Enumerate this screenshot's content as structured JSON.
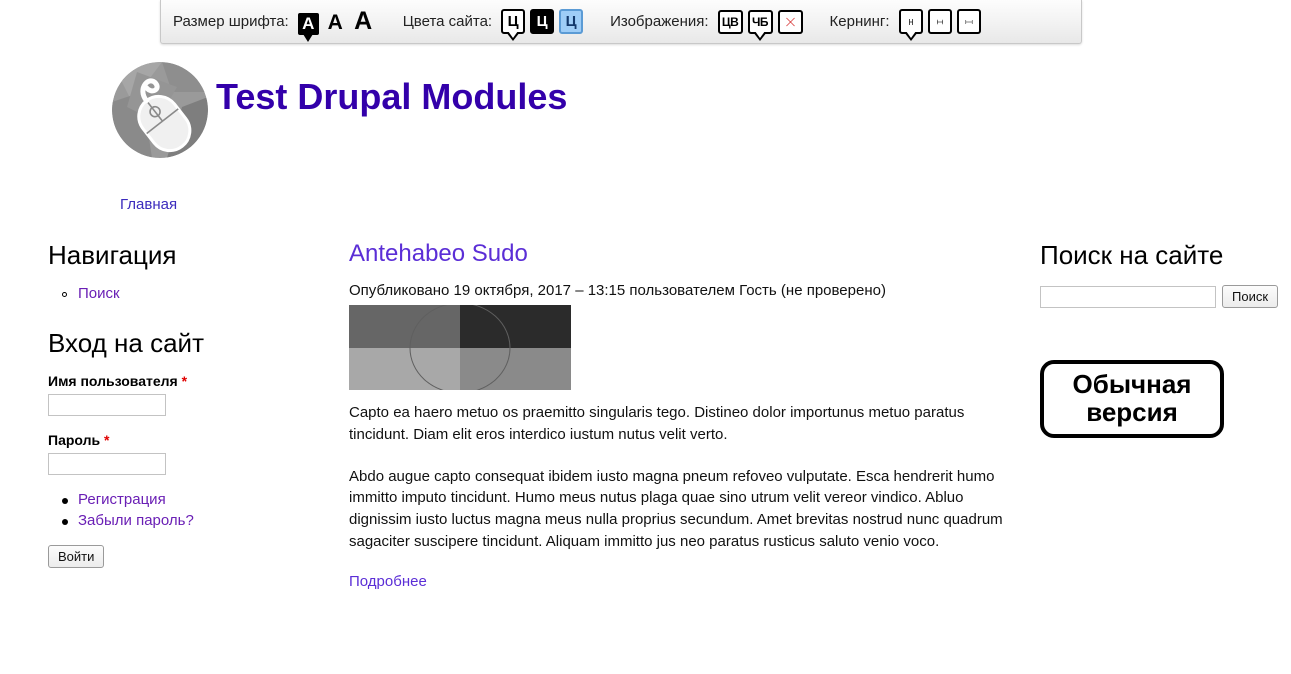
{
  "toolbar": {
    "font_size": {
      "label": "Размер шрифта:",
      "options": [
        {
          "glyph": "A",
          "name": "font-size-small",
          "active": true
        },
        {
          "glyph": "A",
          "name": "font-size-medium",
          "active": false
        },
        {
          "glyph": "A",
          "name": "font-size-large",
          "active": false
        }
      ]
    },
    "site_colors": {
      "label": "Цвета сайта:",
      "options": [
        {
          "glyph": "Ц",
          "name": "color-scheme-white",
          "active": true
        },
        {
          "glyph": "Ц",
          "name": "color-scheme-black",
          "active": false
        },
        {
          "glyph": "Ц",
          "name": "color-scheme-blue",
          "active": false
        }
      ]
    },
    "images": {
      "label": "Изображения:",
      "options": [
        {
          "glyph": "ЦВ",
          "name": "images-color",
          "active": false
        },
        {
          "glyph": "ЧБ",
          "name": "images-grayscale",
          "active": true
        },
        {
          "glyph": "",
          "name": "images-off",
          "active": false
        }
      ]
    },
    "kerning": {
      "label": "Кернинг:",
      "options": [
        {
          "name": "kerning-normal",
          "active": true
        },
        {
          "name": "kerning-medium",
          "active": false
        },
        {
          "name": "kerning-wide",
          "active": false
        }
      ]
    }
  },
  "header": {
    "site_title": "Test Drupal Modules",
    "logo_alt": "mouse-logo",
    "menu": [
      {
        "label": "Главная",
        "name": "main-menu-home"
      }
    ]
  },
  "sidebar_first": {
    "navigation": {
      "title": "Навигация",
      "items": [
        {
          "label": "Поиск",
          "name": "nav-item-search"
        }
      ]
    },
    "login": {
      "title": "Вход на сайт",
      "username_label": "Имя пользователя",
      "username_value": "",
      "password_label": "Пароль",
      "password_value": "",
      "required_mark": "*",
      "links": [
        {
          "label": "Регистрация",
          "name": "register-link"
        },
        {
          "label": "Забыли пароль?",
          "name": "forgot-password-link"
        }
      ],
      "submit_label": "Войти"
    }
  },
  "content": {
    "node_title": "Antehabeo Sudo",
    "submitted": "Опубликовано 19 октября, 2017 – 13:15 пользователем Гость (не проверено)",
    "image": {
      "name": "node-placeholder-image",
      "quadrants": [
        "#666666",
        "#2b2b2b",
        "#a8a8a8",
        "#8a8a8a"
      ],
      "circle_stroke": "#5f5f5f"
    },
    "paragraphs": [
      "Capto ea haero metuo os praemitto singularis tego. Distineo dolor importunus metuo paratus tincidunt. Diam elit eros interdico iustum nutus velit verto.",
      "Abdo augue capto consequat ibidem iusto magna pneum refoveo vulputate. Esca hendrerit humo immitto imputo tincidunt. Humo meus nutus plaga quae sino utrum velit vereor vindico. Abluo dignissim iusto luctus magna meus nulla proprius secundum. Amet brevitas nostrud nunc quadrum sagaciter suscipere tincidunt. Aliquam immitto jus neo paratus rusticus saluto venio voco."
    ],
    "read_more": "Подробнее"
  },
  "sidebar_second": {
    "search": {
      "title": "Поиск на сайте",
      "input_value": "",
      "button_label": "Поиск"
    },
    "normal_version_button": "Обычная версия"
  },
  "colors": {
    "site_title": "#3300aa",
    "link": "#5b2ed6",
    "menu_link": "#6a1fb5",
    "required": "#e00000",
    "accent_blue": "#9ecdf7"
  }
}
